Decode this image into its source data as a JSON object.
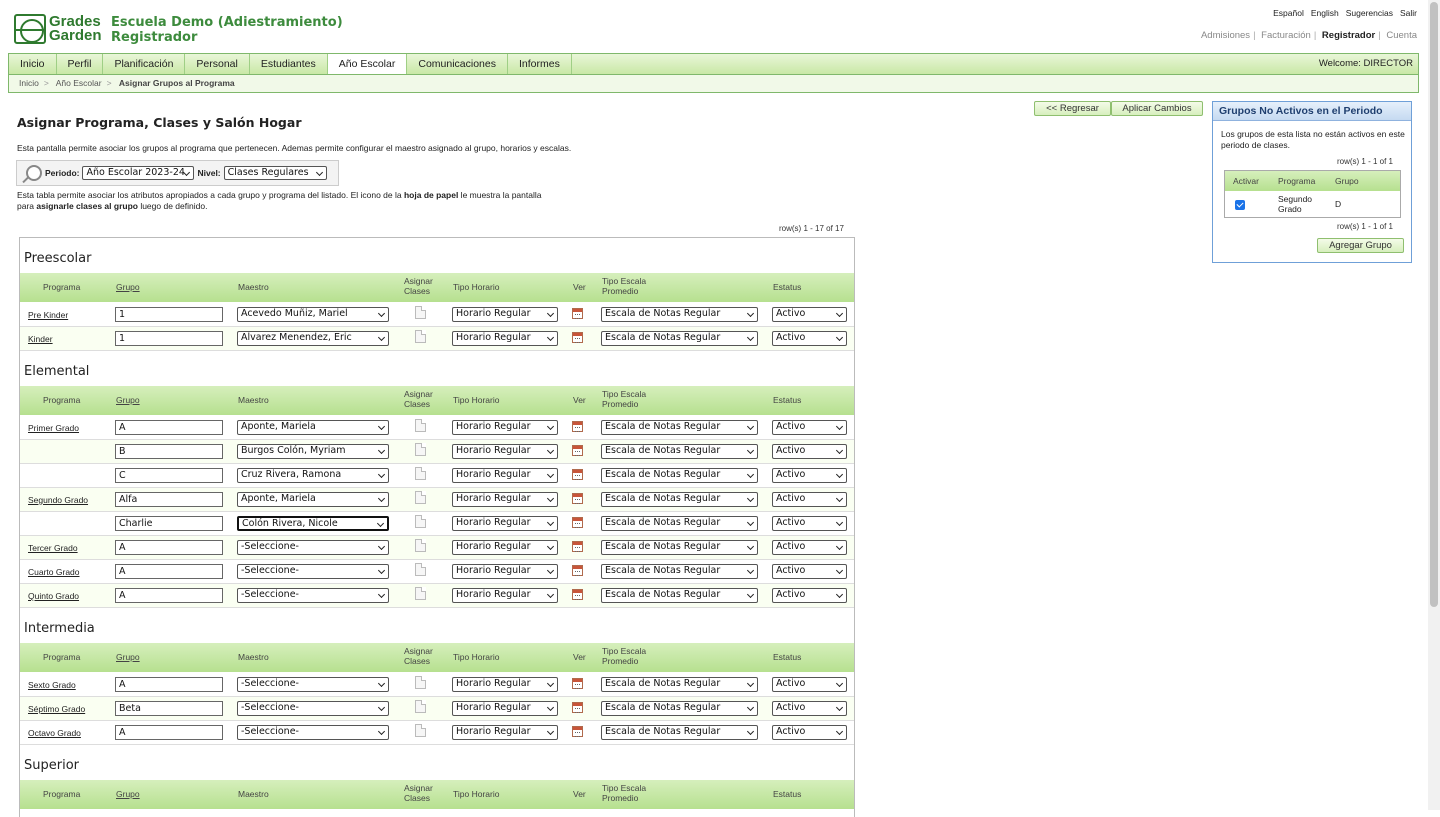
{
  "brand": {
    "logo_line1": "Grades",
    "logo_line2": "Garden",
    "school_line1": "Escuela Demo (Adiestramiento)",
    "school_line2": "Registrador"
  },
  "top_links": [
    "Español",
    "English",
    "Sugerencias",
    "Salir"
  ],
  "module_links": [
    {
      "label": "Admisiones"
    },
    {
      "label": "Facturación"
    },
    {
      "label": "Registrador",
      "active": true
    },
    {
      "label": "Cuenta"
    }
  ],
  "nav": {
    "tabs": [
      "Inicio",
      "Perfil",
      "Planificación",
      "Personal",
      "Estudiantes",
      "Año Escolar",
      "Comunicaciones",
      "Informes"
    ],
    "active": "Año Escolar",
    "welcome": "Welcome: DIRECTOR"
  },
  "breadcrumb": [
    "Inicio",
    "Año Escolar",
    "Asignar Grupos al Programa"
  ],
  "buttons": {
    "back": "<< Regresar",
    "apply": "Aplicar Cambios",
    "add_group": "Agregar Grupo"
  },
  "page": {
    "title": "Asignar Programa, Clases y Salón Hogar",
    "description": "Esta pantalla permite asociar los grupos al programa que pertenecen. Ademas permite configurar el maestro asignado al grupo, horarios y escalas.",
    "help_part1": "Esta tabla permite asociar los atributos apropiados a cada grupo y programa del listado. El icono de la ",
    "help_bold1": "hoja de papel",
    "help_part2": " le muestra la pantalla para ",
    "help_bold2": "asignarle clases al grupo",
    "help_part3": " luego de definido.",
    "rowcount": "row(s) 1 - 17 of 17"
  },
  "filter": {
    "periodo_label": "Periodo:",
    "periodo_value": "Año Escolar 2023-24",
    "nivel_label": "Nivel:",
    "nivel_value": "Clases Regulares"
  },
  "columns": {
    "programa": "Programa",
    "grupo": "Grupo",
    "maestro": "Maestro",
    "asignar1": "Asignar",
    "asignar2": "Clases",
    "tipo_horario": "Tipo Horario",
    "ver": "Ver",
    "escala1": "Tipo Escala",
    "escala2": "Promedio",
    "estatus": "Estatus"
  },
  "sections": [
    {
      "name": "Preescolar",
      "rows": [
        {
          "programa": "Pre Kinder",
          "grupo": "1",
          "maestro": "Acevedo Muñiz, Mariel",
          "horario": "Horario Regular",
          "escala": "Escala de Notas Regular",
          "estatus": "Activo"
        },
        {
          "programa": "Kinder",
          "grupo": "1",
          "maestro": "Alvarez Menendez, Eric",
          "horario": "Horario Regular",
          "escala": "Escala de Notas Regular",
          "estatus": "Activo"
        }
      ]
    },
    {
      "name": "Elemental",
      "rows": [
        {
          "programa": "Primer Grado",
          "grupo": "A",
          "maestro": "Aponte, Mariela",
          "horario": "Horario Regular",
          "escala": "Escala de Notas Regular",
          "estatus": "Activo"
        },
        {
          "programa": "",
          "grupo": "B",
          "maestro": "Burgos Colón, Myriam",
          "horario": "Horario Regular",
          "escala": "Escala de Notas Regular",
          "estatus": "Activo"
        },
        {
          "programa": "",
          "grupo": "C",
          "maestro": "Cruz Rivera, Ramona",
          "horario": "Horario Regular",
          "escala": "Escala de Notas Regular",
          "estatus": "Activo"
        },
        {
          "programa": "Segundo Grado",
          "grupo": "Alfa",
          "maestro": "Aponte, Mariela",
          "horario": "Horario Regular",
          "escala": "Escala de Notas Regular",
          "estatus": "Activo"
        },
        {
          "programa": "",
          "grupo": "Charlie",
          "maestro": "Colón Rivera, Nicole",
          "horario": "Horario Regular",
          "escala": "Escala de Notas Regular",
          "estatus": "Activo",
          "focused": true
        },
        {
          "programa": "Tercer Grado",
          "grupo": "A",
          "maestro": "-Seleccione-",
          "horario": "Horario Regular",
          "escala": "Escala de Notas Regular",
          "estatus": "Activo"
        },
        {
          "programa": "Cuarto Grado",
          "grupo": "A",
          "maestro": "-Seleccione-",
          "horario": "Horario Regular",
          "escala": "Escala de Notas Regular",
          "estatus": "Activo"
        },
        {
          "programa": "Quinto Grado",
          "grupo": "A",
          "maestro": "-Seleccione-",
          "horario": "Horario Regular",
          "escala": "Escala de Notas Regular",
          "estatus": "Activo"
        }
      ]
    },
    {
      "name": "Intermedia",
      "rows": [
        {
          "programa": "Sexto Grado",
          "grupo": "A",
          "maestro": "-Seleccione-",
          "horario": "Horario Regular",
          "escala": "Escala de Notas Regular",
          "estatus": "Activo"
        },
        {
          "programa": "Séptimo Grado",
          "grupo": "Beta",
          "maestro": "-Seleccione-",
          "horario": "Horario Regular",
          "escala": "Escala de Notas Regular",
          "estatus": "Activo"
        },
        {
          "programa": "Octavo Grado",
          "grupo": "A",
          "maestro": "-Seleccione-",
          "horario": "Horario Regular",
          "escala": "Escala de Notas Regular",
          "estatus": "Activo"
        }
      ]
    },
    {
      "name": "Superior",
      "rows": []
    }
  ],
  "sidebar": {
    "title": "Grupos No Activos en el Periodo",
    "description": "Los grupos de esta lista no están activos en este periodo de clases.",
    "rowcount": "row(s) 1 - 1 of 1",
    "columns": [
      "Activar",
      "Programa",
      "Grupo"
    ],
    "rows": [
      {
        "activar": true,
        "programa1": "Segundo",
        "programa2": "Grado",
        "grupo": "D"
      }
    ]
  }
}
